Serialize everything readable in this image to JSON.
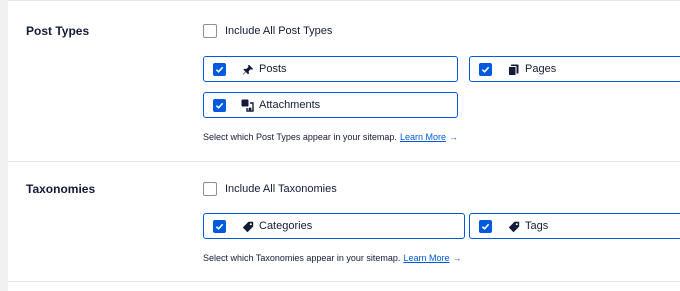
{
  "post_types": {
    "title": "Post Types",
    "include_all": {
      "label": "Include All Post Types",
      "checked": false
    },
    "items": [
      {
        "label": "Posts",
        "icon": "pushpin-icon",
        "checked": true
      },
      {
        "label": "Pages",
        "icon": "pages-icon",
        "checked": true
      },
      {
        "label": "Attachments",
        "icon": "media-icon",
        "checked": true
      }
    ],
    "help_text": "Select which Post Types appear in your sitemap.",
    "learn_more": "Learn More",
    "arrow": "→"
  },
  "taxonomies": {
    "title": "Taxonomies",
    "include_all": {
      "label": "Include All Taxonomies",
      "checked": false
    },
    "items": [
      {
        "label": "Categories",
        "icon": "tag-icon",
        "checked": true
      },
      {
        "label": "Tags",
        "icon": "tag-icon",
        "checked": true
      }
    ],
    "help_text": "Select which Taxonomies appear in your sitemap.",
    "learn_more": "Learn More",
    "arrow": "→"
  },
  "colors": {
    "accent": "#005ae0",
    "text": "#141b38",
    "border": "#e8e8eb"
  }
}
